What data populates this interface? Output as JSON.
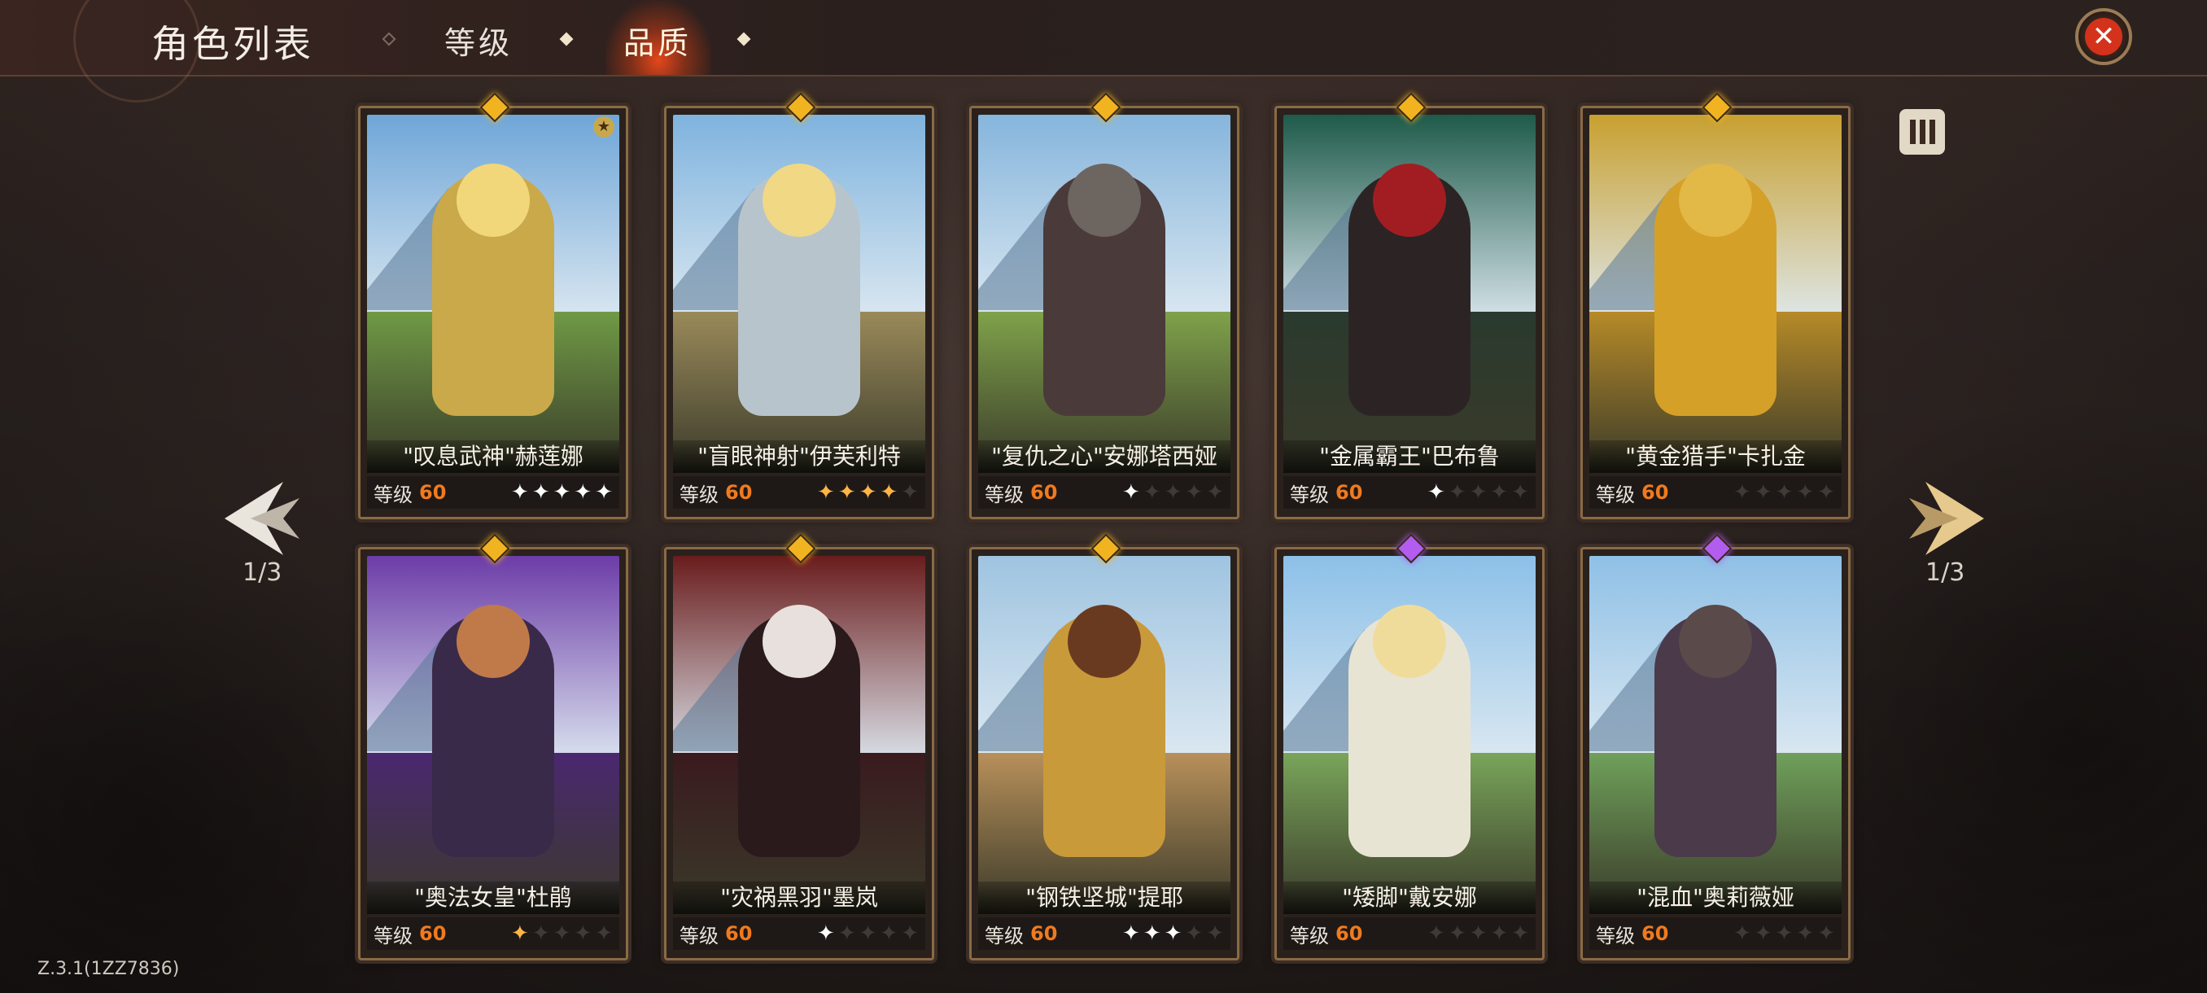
{
  "header": {
    "title": "角色列表",
    "tabs": [
      {
        "label": "等级",
        "active": false
      },
      {
        "label": "品质",
        "active": true
      }
    ],
    "close_icon": "close-icon"
  },
  "pagination": {
    "left_label": "1/3",
    "right_label": "1/3"
  },
  "level_label": "等级",
  "cards": [
    {
      "name": "\"叹息武神\"赫莲娜",
      "level": "60",
      "stars_on": 5,
      "stars_total": 5,
      "gem": "gold",
      "badge": "★",
      "theme": "a"
    },
    {
      "name": "\"盲眼神射\"伊芙利特",
      "level": "60",
      "stars_on": 4,
      "stars_total": 5,
      "gem": "gold",
      "theme": "b",
      "gold_stars": true
    },
    {
      "name": "\"复仇之心\"安娜塔西娅",
      "level": "60",
      "stars_on": 1,
      "stars_total": 5,
      "gem": "gold",
      "theme": "c"
    },
    {
      "name": "\"金属霸王\"巴布鲁",
      "level": "60",
      "stars_on": 1,
      "stars_total": 5,
      "gem": "gold",
      "theme": "d"
    },
    {
      "name": "\"黄金猎手\"卡扎金",
      "level": "60",
      "stars_on": 0,
      "stars_total": 5,
      "gem": "gold",
      "theme": "e"
    },
    {
      "name": "\"奥法女皇\"杜鹃",
      "level": "60",
      "stars_on": 1,
      "stars_total": 5,
      "gem": "gold",
      "theme": "f",
      "gold_stars": true
    },
    {
      "name": "\"灾祸黑羽\"墨岚",
      "level": "60",
      "stars_on": 1,
      "stars_total": 5,
      "gem": "gold",
      "theme": "g"
    },
    {
      "name": "\"钢铁坚城\"提耶",
      "level": "60",
      "stars_on": 3,
      "stars_total": 5,
      "gem": "gold",
      "theme": "h"
    },
    {
      "name": "\"矮脚\"戴安娜",
      "level": "60",
      "stars_on": 0,
      "stars_total": 5,
      "gem": "purple",
      "theme": "i"
    },
    {
      "name": "\"混血\"奥莉薇娅",
      "level": "60",
      "stars_on": 0,
      "stars_total": 5,
      "gem": "purple",
      "theme": "j"
    }
  ],
  "version": "Z.3.1(1ZZ7836)",
  "colors": {
    "accent_orange": "#f07a1e",
    "gem_gold": "#f2b320",
    "gem_purple": "#b35cf0",
    "close_red": "#d5321b"
  }
}
